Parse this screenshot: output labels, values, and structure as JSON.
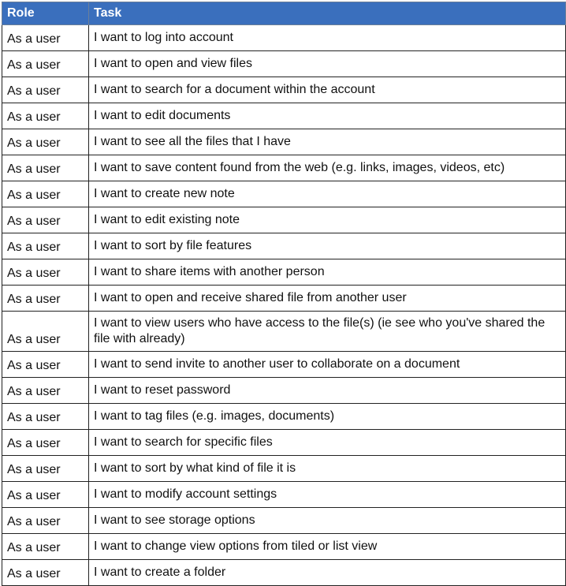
{
  "table": {
    "headers": {
      "role": "Role",
      "task": "Task"
    },
    "rows": [
      {
        "role": "As a user",
        "task": "I want to log into account"
      },
      {
        "role": "As a user",
        "task": "I want to open and view files"
      },
      {
        "role": "As a user",
        "task": "I want to search for a document within the account"
      },
      {
        "role": "As a user",
        "task": "I want to edit documents"
      },
      {
        "role": "As a user",
        "task": "I want to see all the files that I have"
      },
      {
        "role": "As a user",
        "task": "I want to save content found from the web (e.g. links, images, videos, etc)"
      },
      {
        "role": "As a user",
        "task": "I want to create new note"
      },
      {
        "role": "As a user",
        "task": "I want to edit existing note"
      },
      {
        "role": "As a user",
        "task": "I want to sort by file features"
      },
      {
        "role": "As a user",
        "task": "I want to share items with another person"
      },
      {
        "role": "As a user",
        "task": "I want to open and receive shared file from another user"
      },
      {
        "role": "As a user",
        "task": "I want to view users who have access to the file(s) (ie see who you've shared the file with already)"
      },
      {
        "role": "As a user",
        "task": "I want to send invite to another user to collaborate on a document"
      },
      {
        "role": "As a user",
        "task": "I want to reset password"
      },
      {
        "role": "As a user",
        "task": "I want to tag files (e.g. images, documents)"
      },
      {
        "role": "As a user",
        "task": "I want to search for specific files"
      },
      {
        "role": "As a user",
        "task": "I want to sort by what kind of file it is"
      },
      {
        "role": "As a user",
        "task": "I want to modify account settings"
      },
      {
        "role": "As a user",
        "task": "I want to see storage options"
      },
      {
        "role": "As a user",
        "task": "I want to change view options from tiled or list view"
      },
      {
        "role": "As a user",
        "task": "I want to create a folder"
      }
    ]
  },
  "colors": {
    "header_background": "#3a6fbd",
    "header_text": "#ffffff",
    "grid_lines": "#222222"
  }
}
